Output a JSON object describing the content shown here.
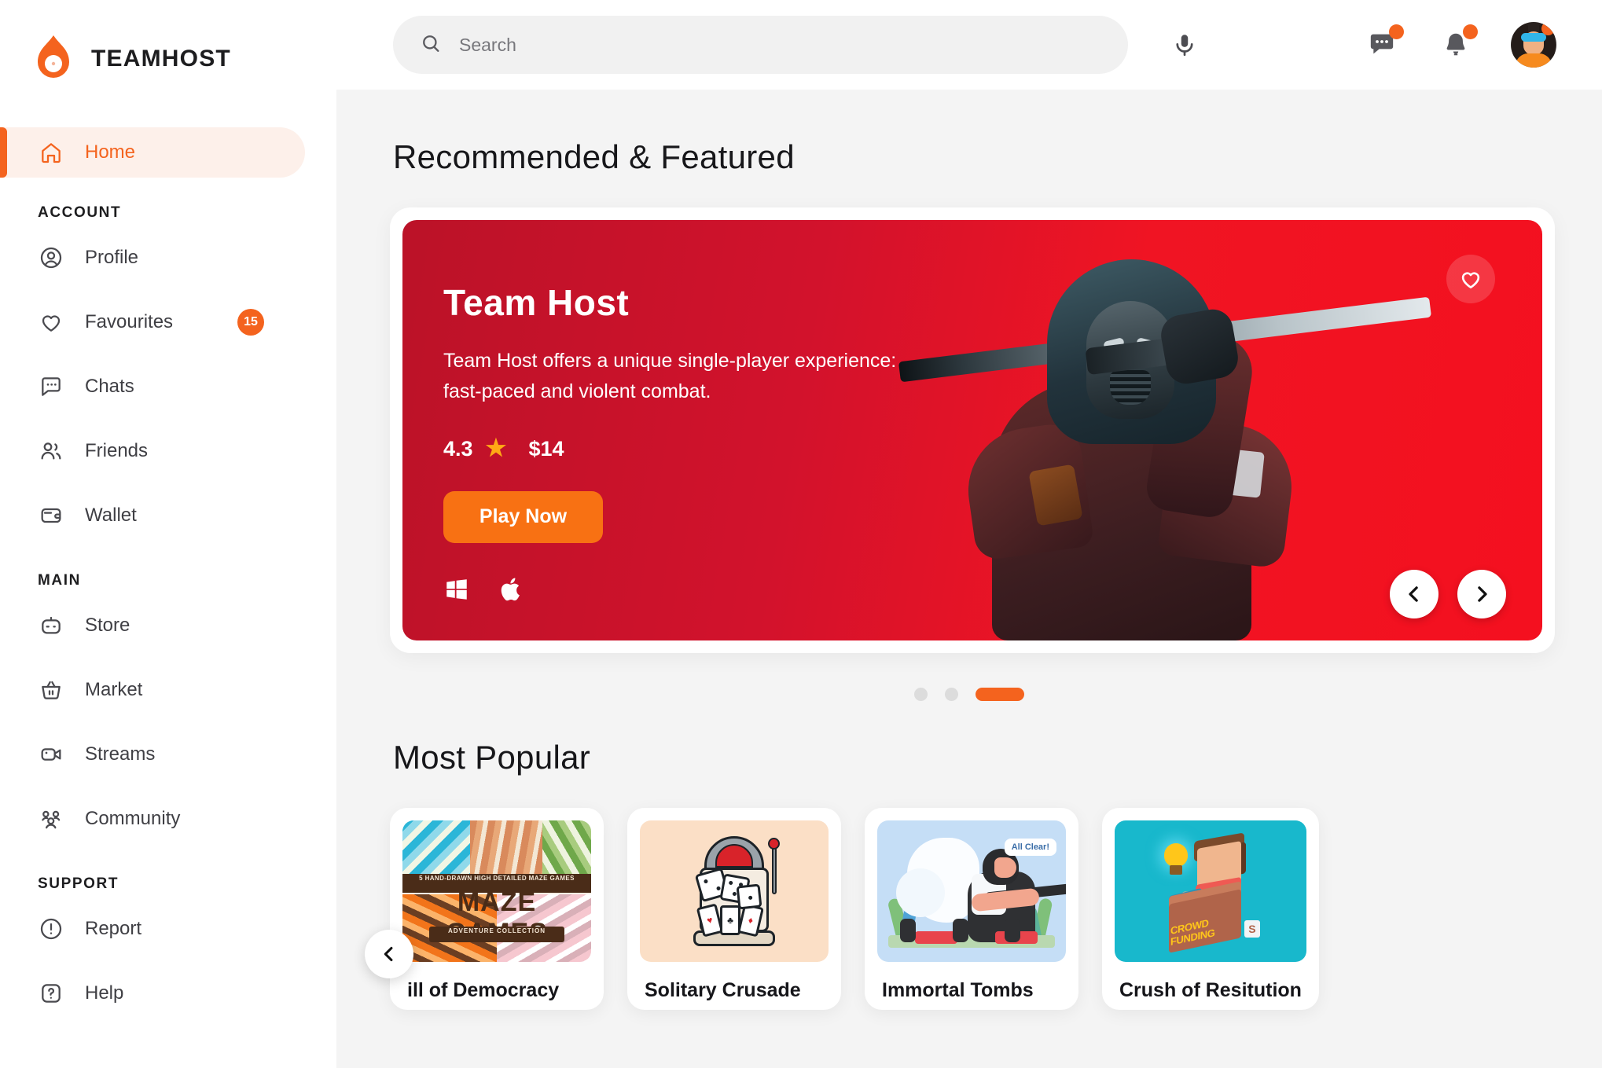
{
  "brand": {
    "name": "TEAMHOST",
    "logo_icon": "flame-logo-icon",
    "accent": "#f4631e"
  },
  "sidebar": {
    "primary": [
      {
        "label": "Home",
        "icon": "home-icon",
        "active": true
      }
    ],
    "sections": [
      {
        "label": "ACCOUNT",
        "items": [
          {
            "label": "Profile",
            "icon": "user-circle-icon",
            "badge": ""
          },
          {
            "label": "Favourites",
            "icon": "heart-icon",
            "badge": "15"
          },
          {
            "label": "Chats",
            "icon": "chat-bubble-icon",
            "badge": ""
          },
          {
            "label": "Friends",
            "icon": "friends-icon",
            "badge": ""
          },
          {
            "label": "Wallet",
            "icon": "wallet-icon",
            "badge": ""
          }
        ]
      },
      {
        "label": "MAIN",
        "items": [
          {
            "label": "Store",
            "icon": "gamepad-icon",
            "badge": ""
          },
          {
            "label": "Market",
            "icon": "basket-icon",
            "badge": ""
          },
          {
            "label": "Streams",
            "icon": "video-camera-icon",
            "badge": ""
          },
          {
            "label": "Community",
            "icon": "community-icon",
            "badge": ""
          }
        ]
      },
      {
        "label": "SUPPORT",
        "items": [
          {
            "label": "Report",
            "icon": "alert-circle-icon",
            "badge": ""
          },
          {
            "label": "Help",
            "icon": "question-square-icon",
            "badge": ""
          }
        ]
      }
    ]
  },
  "topbar": {
    "search": {
      "placeholder": "Search",
      "value": "",
      "icon": "search-icon"
    },
    "mic_icon": "microphone-icon",
    "messages": {
      "icon": "chat-bubble-icon",
      "has_notification": true
    },
    "notifications": {
      "icon": "bell-icon",
      "has_notification": true
    },
    "avatar": {
      "name": "user-avatar",
      "has_notification": true
    }
  },
  "main": {
    "recommended_title": "Recommended & Featured",
    "popular_title": "Most Popular",
    "hero": {
      "title": "Team Host",
      "description_line1": "Team Host offers a unique single-player experience:",
      "description_line2": "fast-paced and violent combat.",
      "rating": "4.3",
      "star_icon": "star-icon",
      "price": "$14",
      "cta_label": "Play Now",
      "platforms": [
        "windows-icon",
        "apple-icon"
      ],
      "favourite_icon": "heart-outline-icon",
      "prev_icon": "chevron-left-icon",
      "next_icon": "chevron-right-icon",
      "background_color": "#ef1320"
    },
    "carousel": {
      "slide_count": 3,
      "active_index": 2
    },
    "cards": [
      {
        "title": "ill of Democracy",
        "art": {
          "kind": "maze-games-cover",
          "top_band_text": "5 HAND-DRAWN HIGH DETAILED MAZE GAMES",
          "main_text": "MAZE GAMES",
          "sub_band_text": "ADVENTURE COLLECTION"
        }
      },
      {
        "title": "Solitary Crusade",
        "art": {
          "kind": "slot-machine-illustration",
          "background_color": "#fbdfc6"
        }
      },
      {
        "title": "Immortal Tombs",
        "art": {
          "kind": "tactical-squad-illustration",
          "background_color": "#c5def6",
          "bubble_text": "All Clear!"
        }
      },
      {
        "title": "Crush of Resitution",
        "art": {
          "kind": "crowdfunding-voxel-illustration",
          "background_color": "#18b8cc",
          "box_text_line1": "CROWD",
          "box_text_line2": "FUNDING",
          "badge_text": "S"
        }
      }
    ],
    "cards_prev_icon": "chevron-left-icon"
  }
}
